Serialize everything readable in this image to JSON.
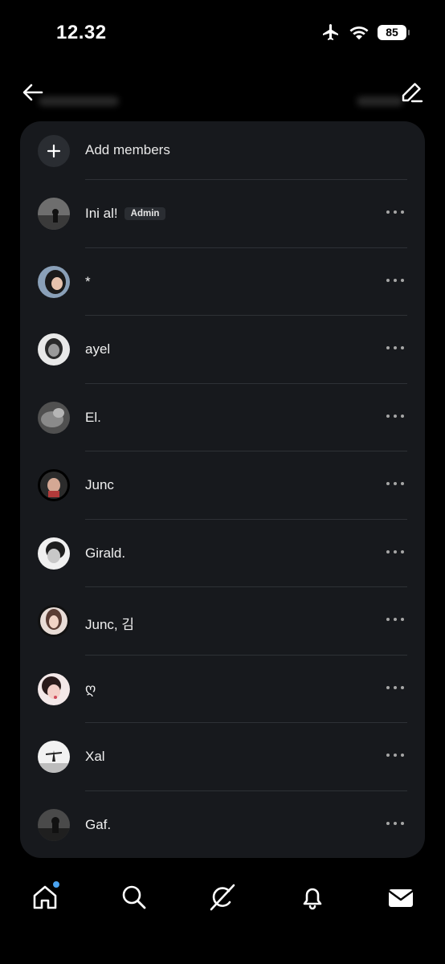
{
  "status_bar": {
    "time": "12.32",
    "battery": "85"
  },
  "panel": {
    "add_label": "Add members",
    "members": [
      {
        "name": "Ini al!",
        "badge": "Admin"
      },
      {
        "name": "*"
      },
      {
        "name": "ayel"
      },
      {
        "name": "El."
      },
      {
        "name": "Junc"
      },
      {
        "name": "Girald."
      },
      {
        "name": "Junc, 김"
      },
      {
        "name": "ღ"
      },
      {
        "name": "Xal"
      },
      {
        "name": "Gaf."
      }
    ]
  },
  "colors": {
    "background": "#000000",
    "panel": "#17191d",
    "divider": "#2e3136",
    "notification_dot": "#4aa3f0"
  },
  "icons": {
    "header": [
      "back-arrow-icon",
      "edit-icon"
    ],
    "nav": [
      "home-icon",
      "search-icon",
      "grok-icon",
      "bell-icon",
      "mail-icon"
    ]
  }
}
